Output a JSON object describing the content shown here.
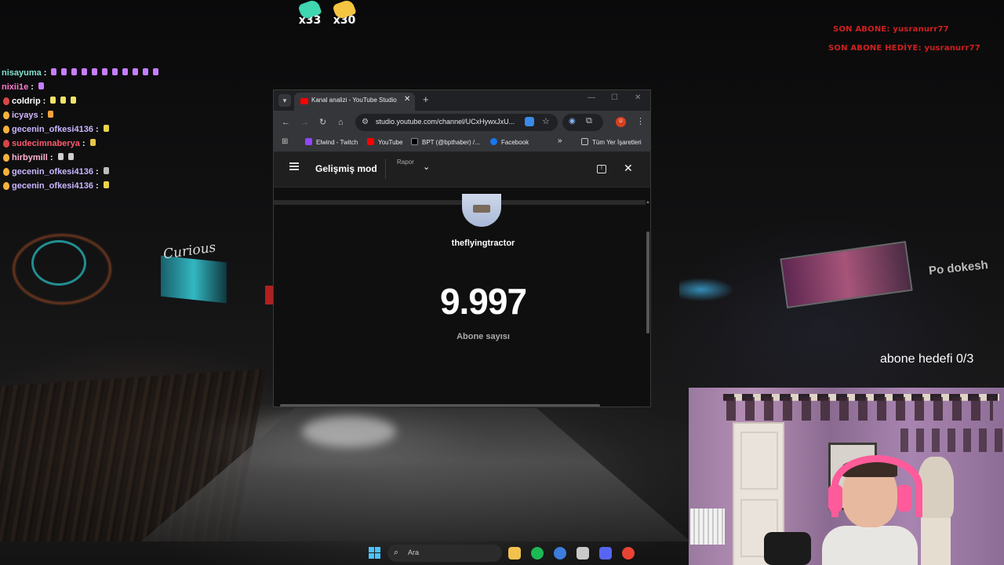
{
  "emotes": [
    {
      "count": "x33",
      "color": "#3fd6b0"
    },
    {
      "count": "x30",
      "color": "#f5c542"
    }
  ],
  "chat": [
    {
      "user": "nisayuma",
      "sep": ":",
      "color": "#7fe3d0",
      "badge": "none",
      "emotes": 11,
      "emote_color": "#c77dff"
    },
    {
      "user": "nixii1e",
      "sep": ":",
      "color": "#ff7bd0",
      "badge": "none",
      "emotes": 1,
      "emote_color": "#c77dff"
    },
    {
      "user": "coldrip",
      "sep": ":",
      "color": "#ffffff",
      "badge": "red",
      "emotes": 3,
      "emote_color": "#f4e36a"
    },
    {
      "user": "icyays",
      "sep": ":",
      "color": "#d4b8ff",
      "badge": "gold",
      "emotes": 1,
      "emote_color": "#f2a33a"
    },
    {
      "user": "gecenin_ofkesi4136",
      "sep": ":",
      "color": "#c9b6ff",
      "badge": "gold",
      "emotes": 1,
      "emote_color": "#e6d54a"
    },
    {
      "user": "sudecimnaberya",
      "sep": ":",
      "color": "#ff5a6e",
      "badge": "red",
      "emotes": 1,
      "emote_color": "#e6c54a"
    },
    {
      "user": "hirbymill",
      "sep": ":",
      "color": "#ffb3d1",
      "badge": "gold",
      "emotes": 2,
      "emote_color": "#cfcfcf"
    },
    {
      "user": "gecenin_ofkesi4136",
      "sep": ":",
      "color": "#c9b6ff",
      "badge": "gold",
      "emotes": 1,
      "emote_color": "#bcbcbc"
    },
    {
      "user": "gecenin_ofkesi4136",
      "sep": ":",
      "color": "#c9b6ff",
      "badge": "gold",
      "emotes": 1,
      "emote_color": "#e6d54a"
    }
  ],
  "alerts": {
    "last_sub": "SON ABONE: yusranurr77",
    "last_gift": "SON ABONE HEDİYE: yusranurr77"
  },
  "overlay_bg_text": {
    "curious": "Curious",
    "podokesh": "Po dokesh"
  },
  "goal": "abone hedefi 0/3",
  "browser": {
    "tab_title": "Kanal analizi - YouTube Studio",
    "tab_close": "✕",
    "new_tab": "+",
    "url": "studio.youtube.com/channel/UCxHywxJxU...",
    "avatar_letter": "U",
    "bookmarks": [
      {
        "label": "Elwind - Twitch",
        "color": "#9146ff"
      },
      {
        "label": "YouTube",
        "color": "#ff0000"
      },
      {
        "label": "BPT (@bpthaber) /...",
        "color": "#000000"
      },
      {
        "label": "Facebook",
        "color": "#1877f2"
      }
    ],
    "bookmarks_more": "»",
    "all_bookmarks": "Tüm Yer İşaretleri"
  },
  "studio": {
    "mode_title": "Gelişmiş mod",
    "report_label": "Rapor",
    "channel_name": "theflyingtractor",
    "subscriber_count": "9.997",
    "subscriber_label": "Abone sayısı"
  },
  "taskbar": {
    "search_placeholder": "Ara",
    "apps": [
      {
        "name": "file-explorer-icon",
        "color": "#f2c14e"
      },
      {
        "name": "spotify-icon",
        "color": "#1db954"
      },
      {
        "name": "browser-blue-icon",
        "color": "#3b7ddd"
      },
      {
        "name": "steam-icon",
        "color": "#c9c9c9"
      },
      {
        "name": "discord-icon",
        "color": "#5865f2"
      },
      {
        "name": "chrome-icon",
        "color": "#ea4335"
      }
    ]
  }
}
